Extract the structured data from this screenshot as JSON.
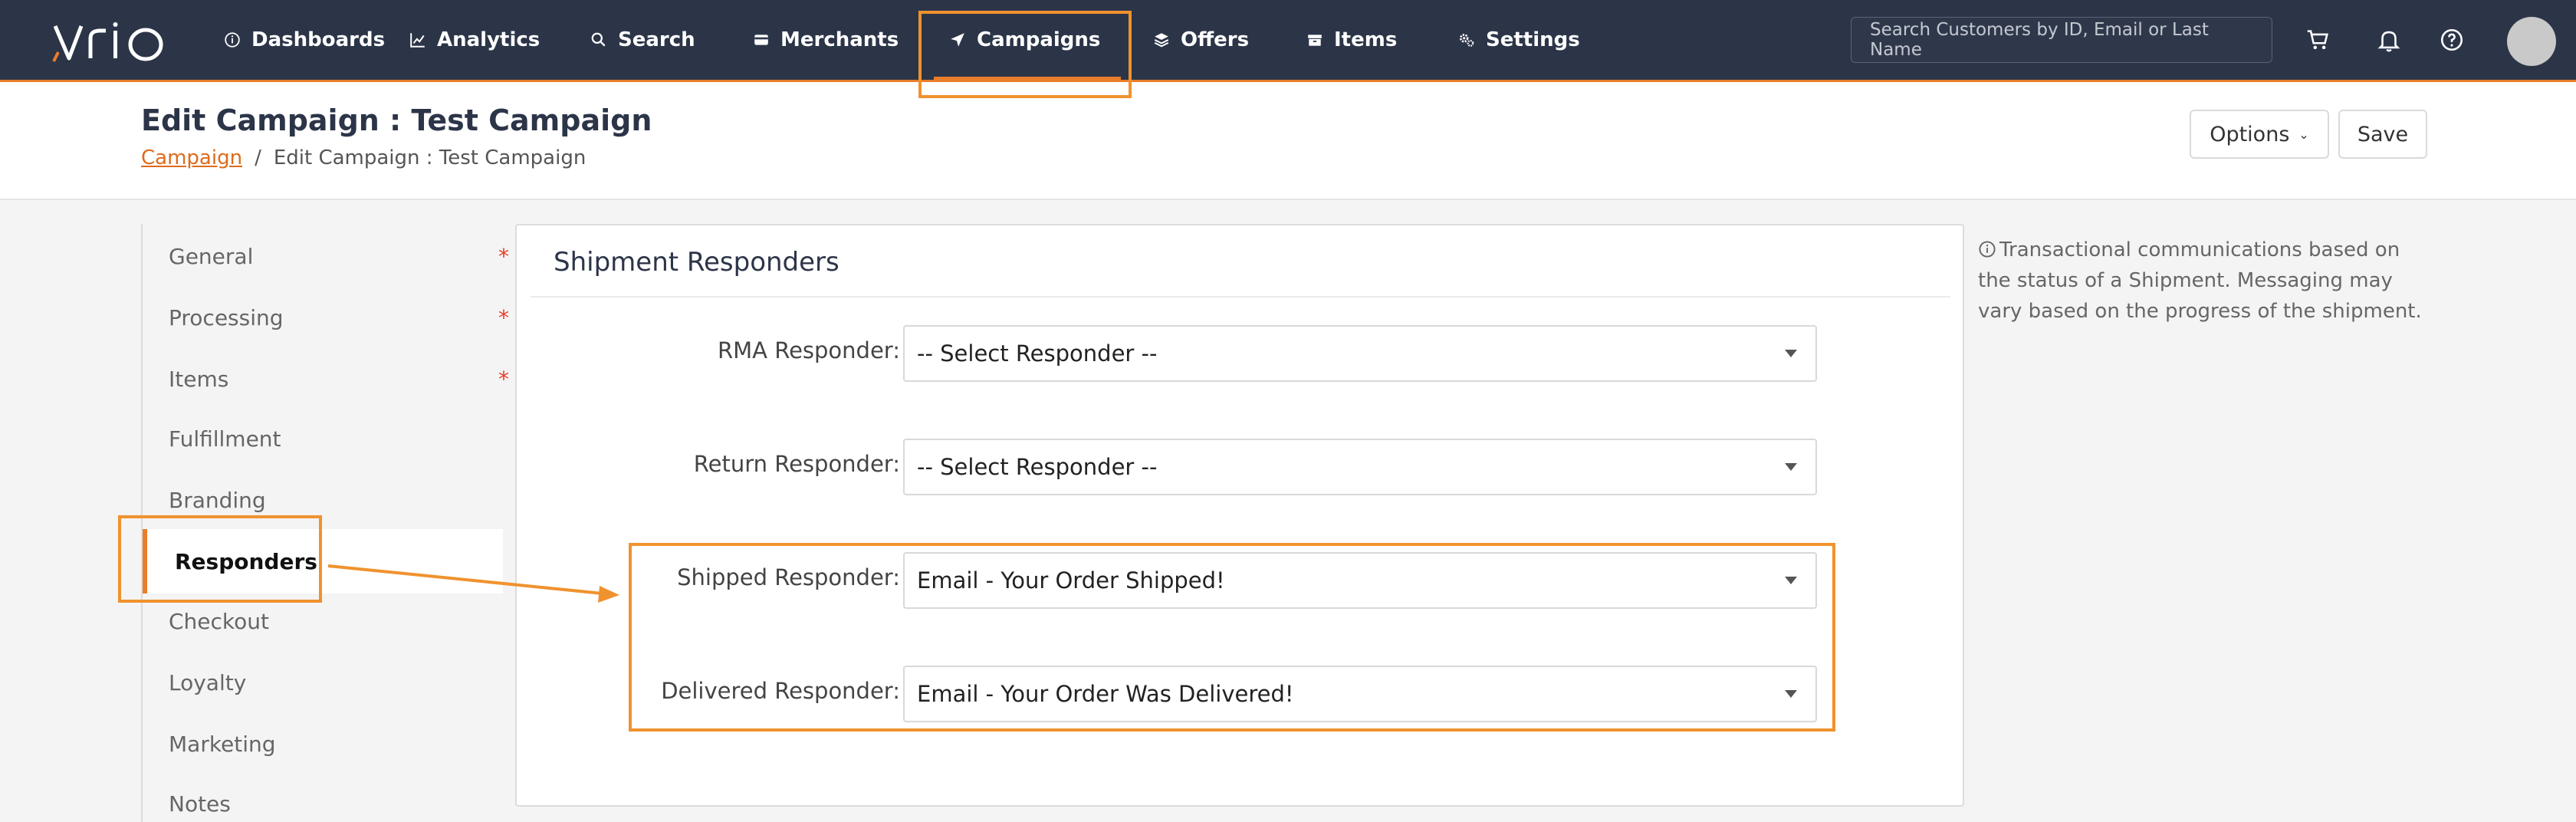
{
  "brand": {
    "logo_text": "vrio",
    "accent": "#e87d2a",
    "nav_bg": "#2c3548"
  },
  "nav": {
    "items": [
      {
        "label": "Dashboards",
        "icon": "info-circle-icon"
      },
      {
        "label": "Analytics",
        "icon": "line-chart-icon"
      },
      {
        "label": "Search",
        "icon": "search-icon"
      },
      {
        "label": "Merchants",
        "icon": "credit-card-icon"
      },
      {
        "label": "Campaigns",
        "icon": "paper-plane-icon",
        "active": true
      },
      {
        "label": "Offers",
        "icon": "layers-icon"
      },
      {
        "label": "Items",
        "icon": "box-icon"
      },
      {
        "label": "Settings",
        "icon": "gears-icon"
      }
    ],
    "search_placeholder": "Search Customers by ID, Email or Last Name"
  },
  "header": {
    "title": "Edit Campaign : Test Campaign",
    "breadcrumb_link": "Campaign",
    "breadcrumb_sep": "/",
    "breadcrumb_current": "Edit Campaign : Test Campaign",
    "options_label": "Options",
    "save_label": "Save"
  },
  "sidebar": {
    "items": [
      {
        "label": "General",
        "required": "*"
      },
      {
        "label": "Processing",
        "required": "*"
      },
      {
        "label": "Items",
        "required": "*"
      },
      {
        "label": "Fulfillment"
      },
      {
        "label": "Branding"
      },
      {
        "label": "Responders",
        "active": true
      },
      {
        "label": "Checkout"
      },
      {
        "label": "Loyalty"
      },
      {
        "label": "Marketing"
      },
      {
        "label": "Notes"
      }
    ]
  },
  "main": {
    "section_title": "Shipment Responders",
    "fields": [
      {
        "label": "RMA Responder:",
        "value": "-- Select Responder --"
      },
      {
        "label": "Return Responder:",
        "value": "-- Select Responder --"
      },
      {
        "label": "Shipped Responder:",
        "value": "Email - Your Order Shipped!"
      },
      {
        "label": "Delivered Responder:",
        "value": "Email - Your Order Was Delivered!"
      }
    ]
  },
  "info_text": "Transactional communications based on the status of a Shipment. Messaging may vary based on the progress of the shipment."
}
